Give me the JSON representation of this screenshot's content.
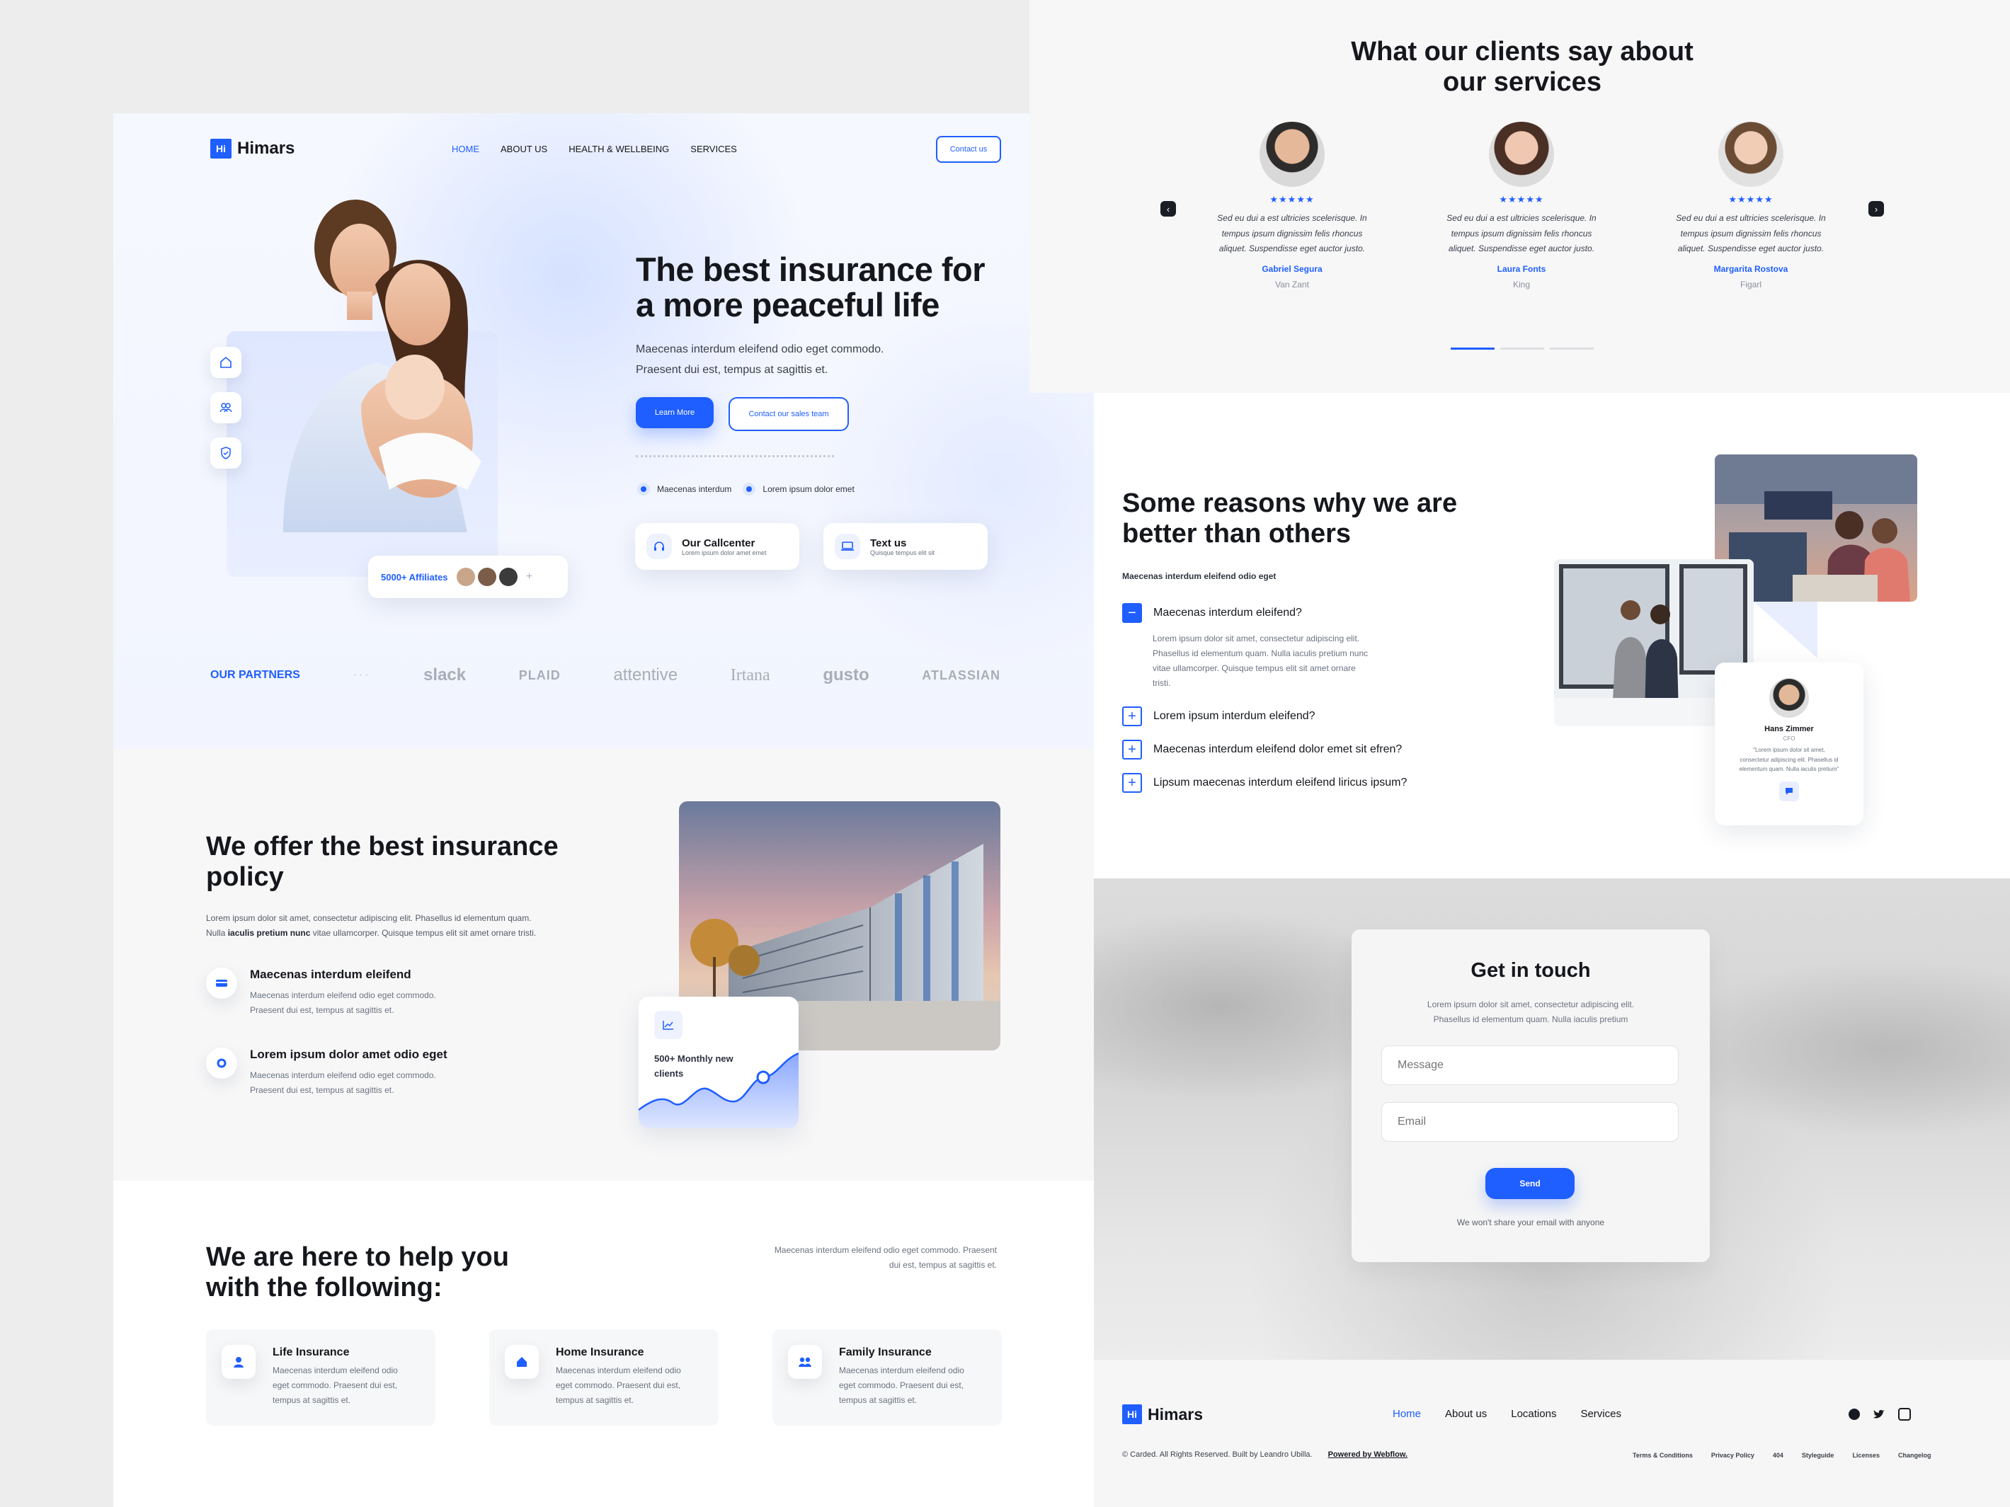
{
  "brand": {
    "logo_badge": "Hi",
    "name": "Himars"
  },
  "nav": {
    "items": [
      "HOME",
      "ABOUT US",
      "HEALTH & WELLBEING",
      "SERVICES"
    ],
    "contact": "Contact us"
  },
  "hero": {
    "title_line1": "The best insurance for",
    "title_line2": "a more peaceful life",
    "subtitle_line1": "Maecenas interdum eleifend odio eget commodo.",
    "subtitle_line2": "Praesent dui est, tempus at sagittis et.",
    "cta_primary": "Learn More",
    "cta_secondary": "Contact our sales team",
    "checks": [
      "Maecenas interdum",
      "Lorem ipsum dolor emet"
    ],
    "callcenter_title": "Our Callcenter",
    "callcenter_sub": "Lorem ipsum dolor amet emet",
    "text_title": "Text us",
    "text_sub": "Quisque tempus elit sit",
    "affiliates": "5000+ Affiliates"
  },
  "partners": {
    "label": "OUR PARTNERS",
    "logos": [
      "slack",
      "PLAID",
      "attentive",
      "Irtana",
      "gusto",
      "ATLASSIAN"
    ]
  },
  "offer": {
    "title_line1": "We offer the best insurance",
    "title_line2": "policy",
    "body_line1": "Lorem ipsum dolor sit amet, consectetur adipiscing elit. Phasellus id elementum quam.",
    "body_line2_prefix": "Nulla ",
    "body_line2_bold": "iaculis pretium nunc",
    "body_line2_suffix": " vitae ullamcorper. Quisque tempus elit sit amet ornare tristi.",
    "features": [
      {
        "title": "Maecenas interdum eleifend",
        "line1": "Maecenas interdum eleifend odio eget commodo.",
        "line2": "Praesent dui est, tempus at sagittis et."
      },
      {
        "title": "Lorem ipsum dolor amet odio eget",
        "line1": "Maecenas interdum eleifend odio eget commodo.",
        "line2": "Praesent dui est, tempus at sagittis et."
      }
    ],
    "stat_line1": "500+ Monthly new",
    "stat_line2": "clients"
  },
  "help": {
    "title_line1": "We are here to help you",
    "title_line2": "with the following:",
    "aside_line1": "Maecenas interdum eleifend odio eget commodo. Praesent",
    "aside_line2": "dui est, tempus at sagittis et.",
    "cards": [
      {
        "title": "Life Insurance",
        "l1": "Maecenas interdum eleifend odio",
        "l2": "eget commodo. Praesent dui est,",
        "l3": "tempus at sagittis et."
      },
      {
        "title": "Home Insurance",
        "l1": "Maecenas interdum eleifend odio",
        "l2": "eget commodo. Praesent dui est,",
        "l3": "tempus at sagittis et."
      },
      {
        "title": "Family Insurance",
        "l1": "Maecenas interdum eleifend odio",
        "l2": "eget commodo. Praesent dui est,",
        "l3": "tempus at sagittis et."
      }
    ]
  },
  "testimonials": {
    "title_line1": "What our clients say about",
    "title_line2": "our services",
    "stars": "★★★★★",
    "quote_l1": "Sed eu dui a est ultricies scelerisque. In",
    "quote_l2": "tempus ipsum dignissim felis rhoncus",
    "quote_l3": "aliquet. Suspendisse eget auctor justo.",
    "people": [
      {
        "name": "Gabriel Segura",
        "role": "Van Zant"
      },
      {
        "name": "Laura Fonts",
        "role": "King"
      },
      {
        "name": "Margarita Rostova",
        "role": "Figarl"
      }
    ]
  },
  "reasons": {
    "title_line1": "Some reasons why we are",
    "title_line2": "better than others",
    "subtitle": "Maecenas interdum eleifend odio eget",
    "faq": [
      "Maecenas interdum eleifend?",
      "Lorem ipsum interdum eleifend?",
      "Maecenas interdum eleifend dolor emet sit efren?",
      "Lipsum maecenas interdum eleifend liricus ipsum?"
    ],
    "answer_l1": "Lorem ipsum dolor sit amet, consectetur adipiscing elit.",
    "answer_l2": "Phasellus id elementum quam. Nulla iaculis pretium nunc",
    "answer_l3": "vitae ullamcorper. Quisque tempus elit sit amet ornare",
    "answer_l4": "tristi.",
    "profile_name": "Hans Zimmer",
    "profile_role": "CFO",
    "profile_q1": "\"Lorem ipsum dolor sit amet,",
    "profile_q2": "consectetur adipiscing elit. Phasellus id",
    "profile_q3": "elementum quam. Nulla iaculis pretium\""
  },
  "contact": {
    "title": "Get in touch",
    "body_l1": "Lorem ipsum dolor sit amet, consectetur adipiscing elit.",
    "body_l2": "Phasellus id elementum quam. Nulla iaculis pretium",
    "message_placeholder": "Message",
    "email_placeholder": "Email",
    "send": "Send",
    "note": "We won't share your email with anyone"
  },
  "footer": {
    "nav": [
      "Home",
      "About us",
      "Locations",
      "Services"
    ],
    "copyright": "© Carded. All Rights Reserved. Built by Leandro Ubilla.",
    "powered": "Powered by Webflow.",
    "links": [
      "Terms & Conditions",
      "Privacy Policy",
      "404",
      "Styleguide",
      "Licenses",
      "Changelog"
    ]
  },
  "colors": {
    "accent": "#1f5eff",
    "text": "#15171c",
    "muted": "#6b7280",
    "page_bg": "#ededed"
  }
}
